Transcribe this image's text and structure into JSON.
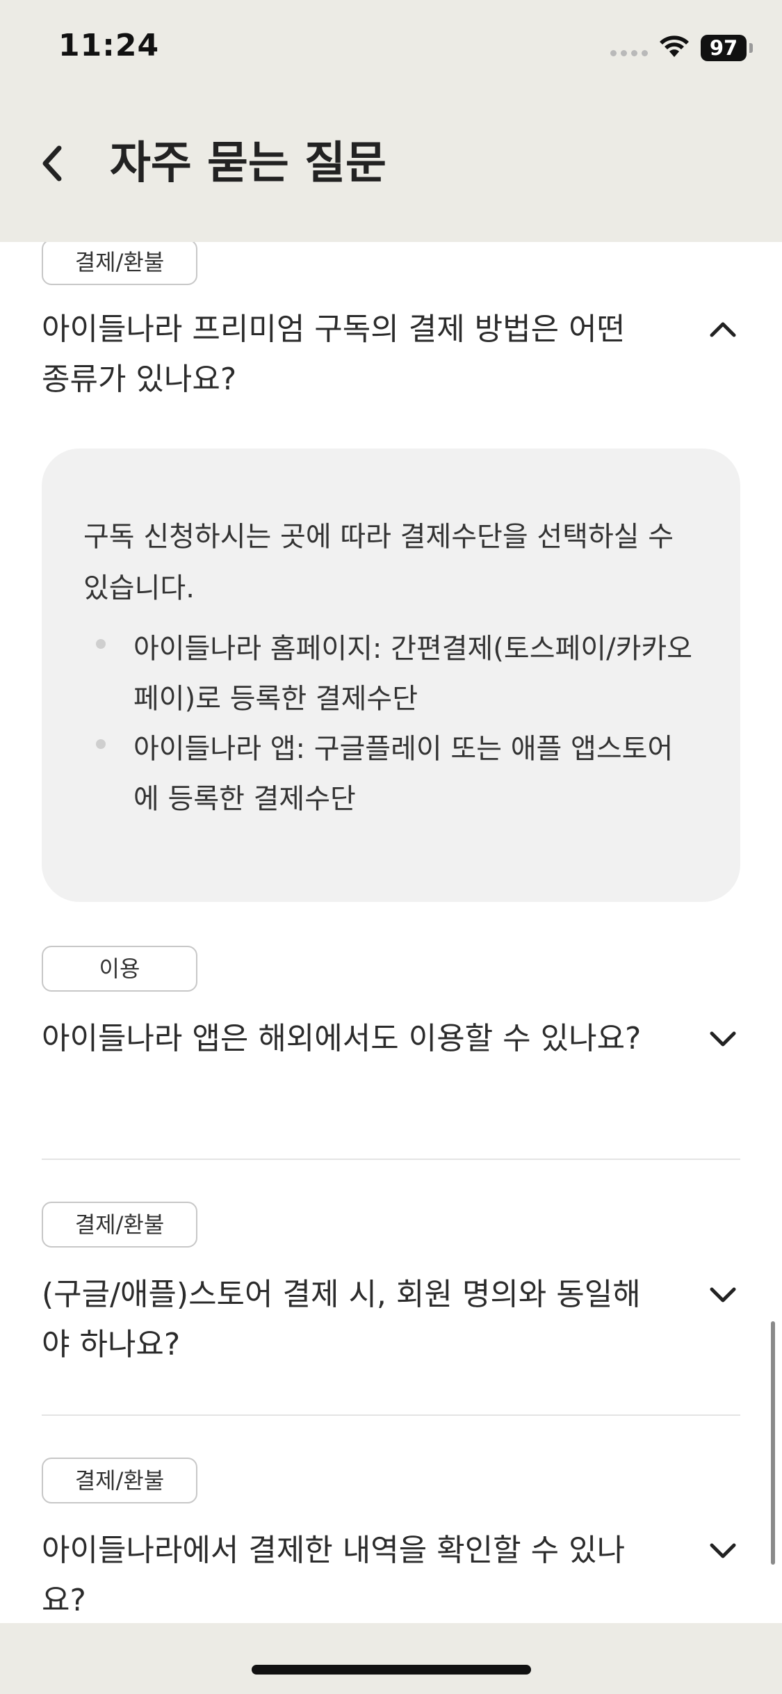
{
  "status_bar": {
    "time": "11:24",
    "battery": "97"
  },
  "header": {
    "title": "자주 묻는 질문",
    "back_icon": "chevron-left-icon"
  },
  "faq": {
    "items": [
      {
        "category": "결제/환불",
        "question": "아이들나라 프리미엄 구독의 결제 방법은 어떤 종류가 있나요?",
        "expanded": true,
        "answer": {
          "intro": "구독 신청하시는 곳에 따라 결제수단을 선택하실 수 있습니다.",
          "bullets": [
            "아이들나라 홈페이지: 간편결제(토스페이/카카오페이)로 등록한 결제수단",
            "아이들나라 앱: 구글플레이 또는 애플 앱스토어에 등록한 결제수단"
          ]
        }
      },
      {
        "category": "이용",
        "question": "아이들나라 앱은 해외에서도 이용할 수 있나요?",
        "expanded": false
      },
      {
        "category": "결제/환불",
        "question": "(구글/애플)스토어 결제 시, 회원 명의와 동일해야 하나요?",
        "expanded": false
      },
      {
        "category": "결제/환불",
        "question": "아이들나라에서 결제한 내역을 확인할 수 있나요?",
        "expanded": false
      }
    ]
  },
  "colors": {
    "header_bg": "#ecebe5",
    "answer_bg": "#f1f1f1",
    "badge_border": "#c7c7c7"
  }
}
